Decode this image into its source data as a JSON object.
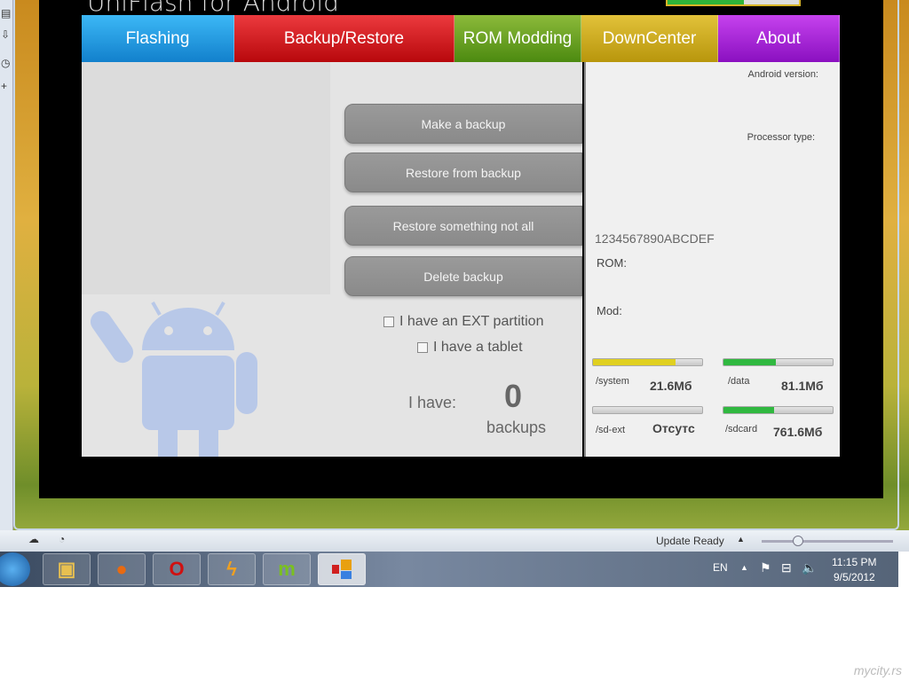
{
  "app": {
    "title": "UniFlash for Android",
    "title_progress": 0.58
  },
  "tabs": [
    {
      "label": "Flashing"
    },
    {
      "label": "Backup/Restore"
    },
    {
      "label": "ROM Modding"
    },
    {
      "label": "DownCenter"
    },
    {
      "label": "About"
    }
  ],
  "backup": {
    "buttons": [
      "Make a backup",
      "Restore from backup",
      "Restore something not all",
      "Delete backup"
    ],
    "checkboxes": [
      {
        "label": "I have an EXT partition",
        "checked": false
      },
      {
        "label": "I have a tablet",
        "checked": false
      }
    ],
    "count_label": "I have:",
    "count": "0",
    "count_unit": "backups"
  },
  "device": {
    "android_version_label": "Android version:",
    "processor_label": "Processor type:",
    "serial": "1234567890ABCDEF",
    "rom_label": "ROM:",
    "mod_label": "Mod:",
    "partitions": [
      {
        "name": "/system",
        "value": "21.6Мб",
        "fill": 0.76,
        "color": "#e0d020"
      },
      {
        "name": "/data",
        "value": "81.1Мб",
        "fill": 0.48,
        "color": "#30b840"
      },
      {
        "name": "/sd-ext",
        "value": "Отсутс",
        "fill": 0,
        "color": "#30b840"
      },
      {
        "name": "/sdcard",
        "value": "761.6Мб",
        "fill": 0.46,
        "color": "#30b840"
      }
    ]
  },
  "statusbar": {
    "text": "Update Ready"
  },
  "taskbar": {
    "lang": "EN",
    "time": "11:15 PM",
    "date": "9/5/2012"
  },
  "watermark": "mycity.rs"
}
